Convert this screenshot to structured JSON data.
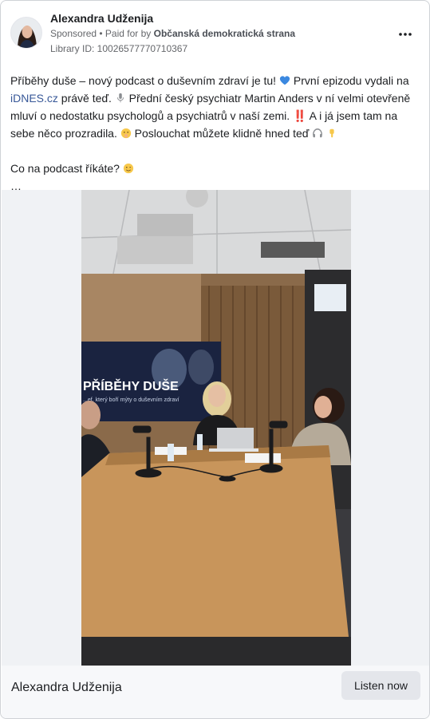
{
  "post": {
    "author": "Alexandra Udženija",
    "sponsored_label": "Sponsored",
    "separator": " • ",
    "paid_for_prefix": "Paid for by ",
    "paid_for_by": "Občanská demokratická strana",
    "library_id": "Library ID: 10026577770710367",
    "more_icon": "more-options-icon"
  },
  "text": {
    "t1": "Příběhy duše – nový podcast o duševním zdraví je tu! ",
    "t2": " První epizodu vydali na ",
    "link": "iDNES.cz",
    "t3": " právě teď. ",
    "t4": " Přední český psychiatr Martin Anders v ní velmi otevřeně mluví o nedostatku psychologů a psychiatrů v naší zemi. ‼️ A i já jsem tam na sebe něco prozradila. ",
    "t5": " Poslouchat můžete klidně hned teď ",
    "question": "Co na podcast říkáte? ",
    "ellipsis": "…",
    "link_color": "#385898"
  },
  "media": {
    "screen_title": "PŘÍBĚHY DUŠE",
    "screen_subtitle": "...ef, který boří mýty o duševním zdraví"
  },
  "footer": {
    "name": "Alexandra Udženija",
    "cta_label": "Listen now"
  }
}
